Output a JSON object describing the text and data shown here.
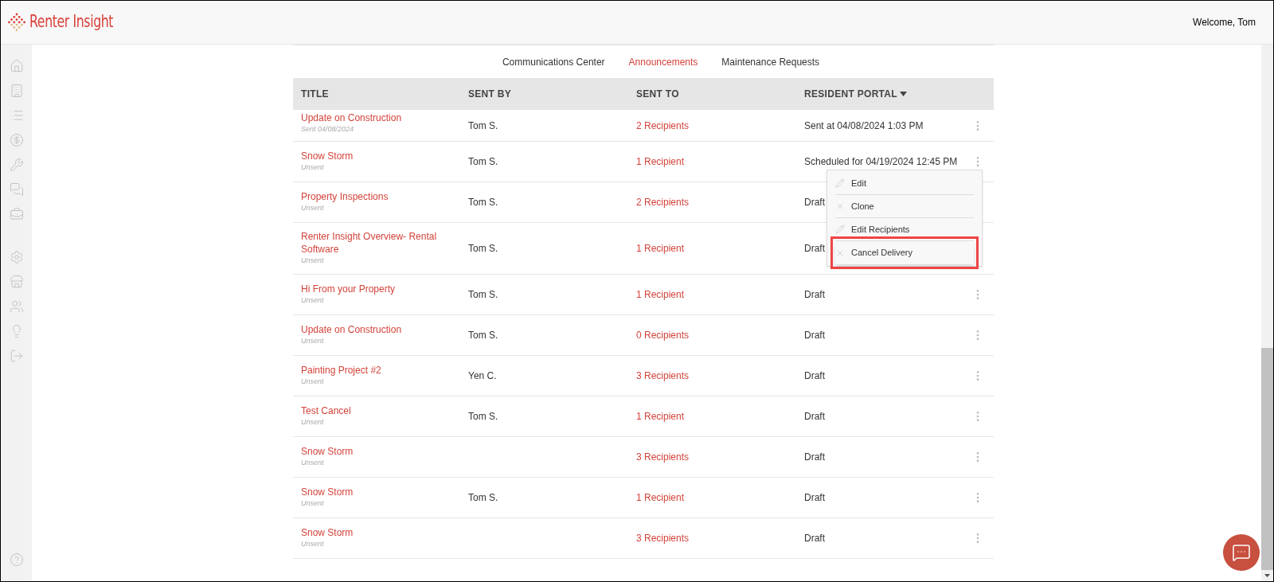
{
  "header": {
    "logo_text": "Renter Insight",
    "welcome": "Welcome, Tom"
  },
  "tabs": [
    {
      "label": "Communications Center",
      "selected": false
    },
    {
      "label": "Announcements",
      "selected": true
    },
    {
      "label": "Maintenance Requests",
      "selected": false
    }
  ],
  "table": {
    "columns": [
      {
        "label": "TITLE",
        "sorted": false
      },
      {
        "label": "SENT BY",
        "sorted": false
      },
      {
        "label": "SENT TO",
        "sorted": false
      },
      {
        "label": "RESIDENT PORTAL",
        "sorted": true
      }
    ],
    "rows": [
      {
        "title": "Update on Construction",
        "status": "Sent 04/08/2024",
        "sent_by": "Tom S.",
        "sent_to": "2 Recipients",
        "portal": "Sent at 04/08/2024 1:03 PM",
        "menu_open": false
      },
      {
        "title": "Snow Storm",
        "status": "Unsent",
        "sent_by": "Tom S.",
        "sent_to": "1 Recipient",
        "portal": "Scheduled for 04/19/2024 12:45 PM",
        "menu_open": true
      },
      {
        "title": "Property Inspections",
        "status": "Unsent",
        "sent_by": "Tom S.",
        "sent_to": "2 Recipients",
        "portal": "Draft",
        "menu_open": false
      },
      {
        "title": "Renter Insight Overview- Rental Software",
        "status": "Unsent",
        "sent_by": "Tom S.",
        "sent_to": "1 Recipient",
        "portal": "Draft",
        "menu_open": false
      },
      {
        "title": "Hi From your Property",
        "status": "Unsent",
        "sent_by": "Tom S.",
        "sent_to": "1 Recipient",
        "portal": "Draft",
        "menu_open": false
      },
      {
        "title": "Update on Construction",
        "status": "Unsent",
        "sent_by": "Tom S.",
        "sent_to": "0 Recipients",
        "portal": "Draft",
        "menu_open": false
      },
      {
        "title": "Painting Project #2",
        "status": "Unsent",
        "sent_by": "Yen C.",
        "sent_to": "3 Recipients",
        "portal": "Draft",
        "menu_open": false
      },
      {
        "title": "Test Cancel",
        "status": "Unsent",
        "sent_by": "Tom S.",
        "sent_to": "1 Recipient",
        "portal": "Draft",
        "menu_open": false
      },
      {
        "title": "Snow Storm",
        "status": "Unsent",
        "sent_to": "3 Recipients",
        "portal": "Draft",
        "menu_open": false
      },
      {
        "title": "Snow Storm",
        "status": "Unsent",
        "sent_by": "Tom S.",
        "sent_to": "1 Recipient",
        "portal": "Draft",
        "menu_open": false
      },
      {
        "title": "Snow Storm",
        "status": "Unsent",
        "sent_to": "3 Recipients",
        "portal": "Draft",
        "menu_open": false
      }
    ]
  },
  "row_menu": {
    "items": [
      {
        "label": "Edit",
        "kind": "pencil",
        "highlighted": false
      },
      {
        "label": "Clone",
        "kind": "cross",
        "highlighted": false
      },
      {
        "label": "Edit Recipients",
        "kind": "pencil",
        "highlighted": false
      },
      {
        "label": "Cancel Delivery",
        "kind": "cross",
        "highlighted": true
      }
    ]
  }
}
